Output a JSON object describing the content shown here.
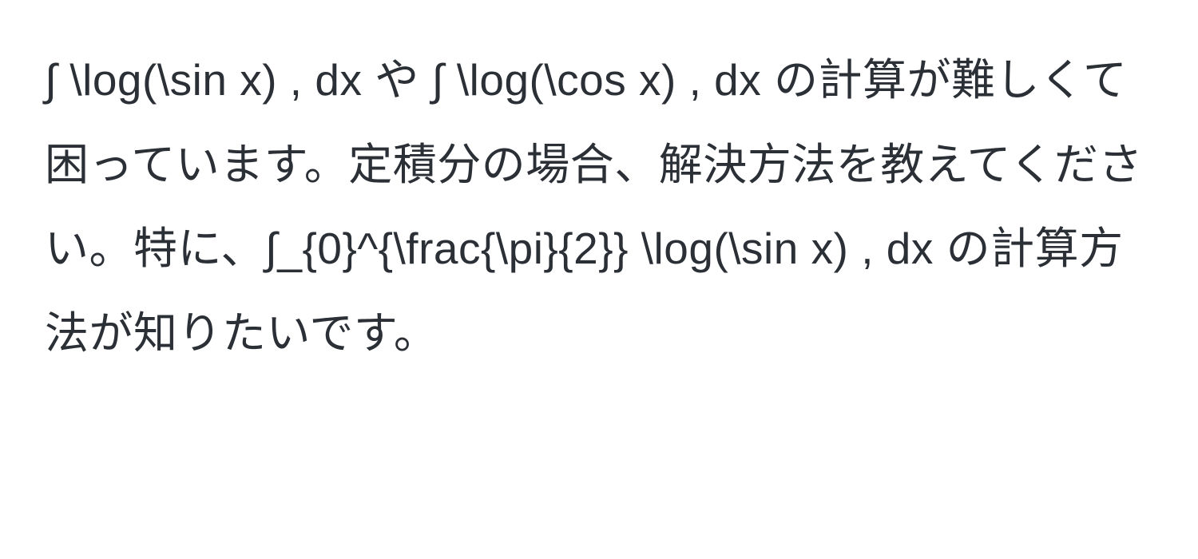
{
  "paragraph": {
    "text": "∫ \\log(\\sin x) , dx や ∫ \\log(\\cos x) , dx の計算が難しくて困っています。定積分の場合、解決方法を教えてください。特に、∫_{0}^{\\frac{\\pi}{2}} \\log(\\sin x) , dx の計算方法が知りたいです。"
  }
}
